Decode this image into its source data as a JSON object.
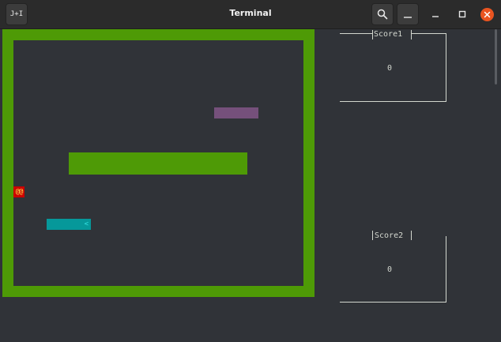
{
  "window": {
    "title": "Terminal",
    "new_tab_icon": "terminal-tab-icon",
    "new_tab_label": "J+I",
    "search_icon": "search-icon",
    "menu_icon": "hamburger-menu-icon",
    "minimize_icon": "minimize-icon",
    "maximize_icon": "maximize-icon",
    "close_icon": "close-icon"
  },
  "game": {
    "player_glyph": "@@",
    "snake_glyph": "<",
    "colors": {
      "wall": "#4e9a06",
      "background": "#303338",
      "food": "#75507b",
      "snake": "#06989a",
      "player": "#cc0000",
      "player_text": "#fce94f"
    }
  },
  "scores": [
    {
      "label": "Score1",
      "value": "0"
    },
    {
      "label": "Score2",
      "value": "0"
    }
  ]
}
